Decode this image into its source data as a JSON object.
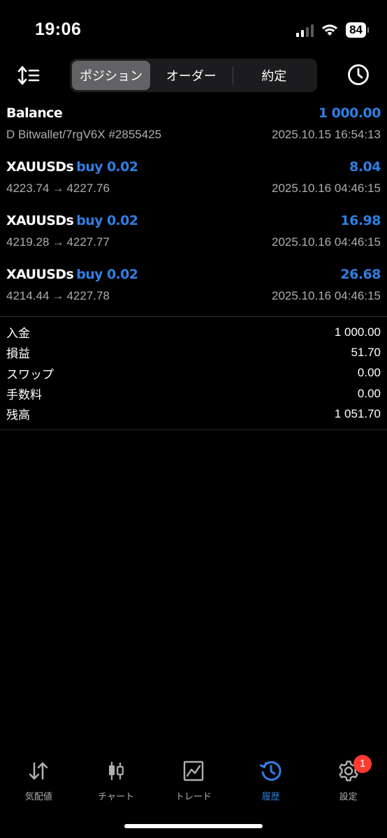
{
  "status": {
    "time": "19:06",
    "battery": "84"
  },
  "toolbar": {
    "tabs": [
      {
        "label": "ポジション"
      },
      {
        "label": "オーダー"
      },
      {
        "label": "約定"
      }
    ]
  },
  "deals": [
    {
      "symbol": "Balance",
      "side": "",
      "volume": "",
      "amount": "1 000.00",
      "detail": "D Bitwallet/7rgV6X #2855425",
      "time": "2025.10.15 16:54:13"
    },
    {
      "symbol": "XAUUSDs",
      "side": "buy",
      "volume": "0.02",
      "amount": "8.04",
      "open": "4223.74",
      "arrow": "→",
      "close": "4227.76",
      "time": "2025.10.16 04:46:15"
    },
    {
      "symbol": "XAUUSDs",
      "side": "buy",
      "volume": "0.02",
      "amount": "16.98",
      "open": "4219.28",
      "arrow": "→",
      "close": "4227.77",
      "time": "2025.10.16 04:46:15"
    },
    {
      "symbol": "XAUUSDs",
      "side": "buy",
      "volume": "0.02",
      "amount": "26.68",
      "open": "4214.44",
      "arrow": "→",
      "close": "4227.78",
      "time": "2025.10.16 04:46:15"
    }
  ],
  "summary": [
    {
      "label": "入金",
      "value": "1 000.00"
    },
    {
      "label": "損益",
      "value": "51.70"
    },
    {
      "label": "スワップ",
      "value": "0.00"
    },
    {
      "label": "手数料",
      "value": "0.00"
    },
    {
      "label": "残高",
      "value": "1 051.70"
    }
  ],
  "nav": [
    {
      "label": "気配値",
      "icon": "quotes-arrows-icon"
    },
    {
      "label": "チャート",
      "icon": "candlestick-icon"
    },
    {
      "label": "トレード",
      "icon": "trade-chart-icon"
    },
    {
      "label": "履歴",
      "icon": "history-clock-icon"
    },
    {
      "label": "設定",
      "icon": "gear-icon",
      "badge": "1"
    }
  ],
  "colors": {
    "accent": "#2f7fe3",
    "badge": "#ff3b30",
    "background": "#000000"
  }
}
